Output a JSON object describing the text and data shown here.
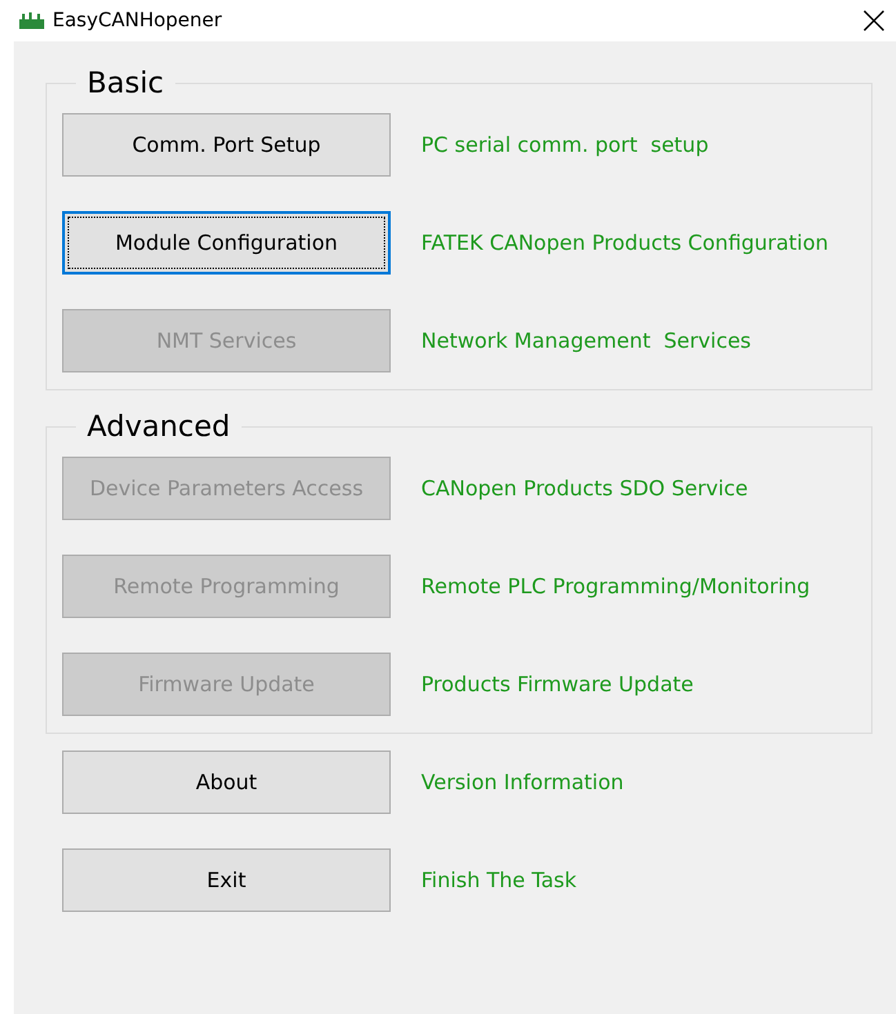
{
  "window": {
    "title": "EasyCANHopener"
  },
  "groups": [
    {
      "title": "Basic",
      "rows": [
        {
          "button": "Comm. Port Setup",
          "disabled": false,
          "focused": false,
          "description": "PC serial comm. port  setup"
        },
        {
          "button": "Module Configuration",
          "disabled": false,
          "focused": true,
          "description": "FATEK CANopen Products Configuration"
        },
        {
          "button": "NMT Services",
          "disabled": true,
          "focused": false,
          "description": "Network Management  Services"
        }
      ]
    },
    {
      "title": "Advanced",
      "rows": [
        {
          "button": "Device Parameters Access",
          "disabled": true,
          "focused": false,
          "description": "CANopen Products SDO Service"
        },
        {
          "button": "Remote Programming",
          "disabled": true,
          "focused": false,
          "description": "Remote PLC Programming/Monitoring"
        },
        {
          "button": "Firmware Update",
          "disabled": true,
          "focused": false,
          "description": "Products Firmware Update"
        }
      ]
    }
  ],
  "bottom_rows": [
    {
      "button": "About",
      "disabled": false,
      "focused": false,
      "description": "Version Information"
    },
    {
      "button": "Exit",
      "disabled": false,
      "focused": false,
      "description": "Finish The Task"
    }
  ]
}
